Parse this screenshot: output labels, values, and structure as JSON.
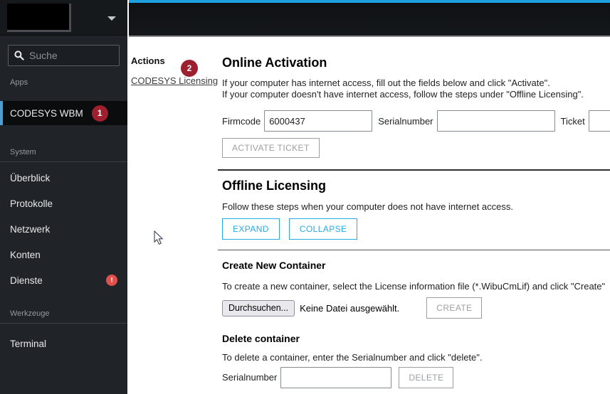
{
  "colors": {
    "accent_blue": "#1e9fe0",
    "button_blue": "#29aae2",
    "badge_dark_red": "#9e1f2e",
    "badge_bright_red": "#e2504c"
  },
  "sidebar": {
    "search_placeholder": "Suche",
    "section_apps": "Apps",
    "apps_items": [
      {
        "label": "CODESYS WBM",
        "badge": "1"
      }
    ],
    "section_system": "System",
    "system_items": [
      {
        "label": "Überblick"
      },
      {
        "label": "Protokolle"
      },
      {
        "label": "Netzwerk"
      },
      {
        "label": "Konten"
      },
      {
        "label": "Dienste",
        "badge": "!"
      }
    ],
    "section_werkzeuge": "Werkzeuge",
    "werkzeuge_items": [
      {
        "label": "Terminal"
      }
    ]
  },
  "actions_panel": {
    "title": "Actions",
    "badge": "2",
    "link": "CODESYS Licensing"
  },
  "online_activation": {
    "title": "Online Activation",
    "line1": "If your computer has internet access, fill out the fields below and click \"Activate\".",
    "line2": "If your computer doesn't have internet access, follow the steps under \"Offline Licensing\".",
    "firmcode_label": "Firmcode",
    "firmcode_value": "6000437",
    "serialnumber_label": "Serialnumber",
    "ticket_label": "Ticket",
    "activate_button": "ACTIVATE TICKET"
  },
  "offline_licensing": {
    "title": "Offline Licensing",
    "description": "Follow these steps when your computer does not have internet access.",
    "expand_button": "EXPAND",
    "collapse_button": "COLLAPSE"
  },
  "create_container": {
    "title": "Create New Container",
    "description": "To create a new container, select the License information file (*.WibuCmLif) and click \"Create\"",
    "browse_button": "Durchsuchen...",
    "no_file_text": "Keine Datei ausgewählt.",
    "create_button": "CREATE"
  },
  "delete_container": {
    "title": "Delete container",
    "description": "To delete a container, enter the Serialnumber and click \"delete\".",
    "serialnumber_label": "Serialnumber",
    "delete_button": "DELETE"
  }
}
